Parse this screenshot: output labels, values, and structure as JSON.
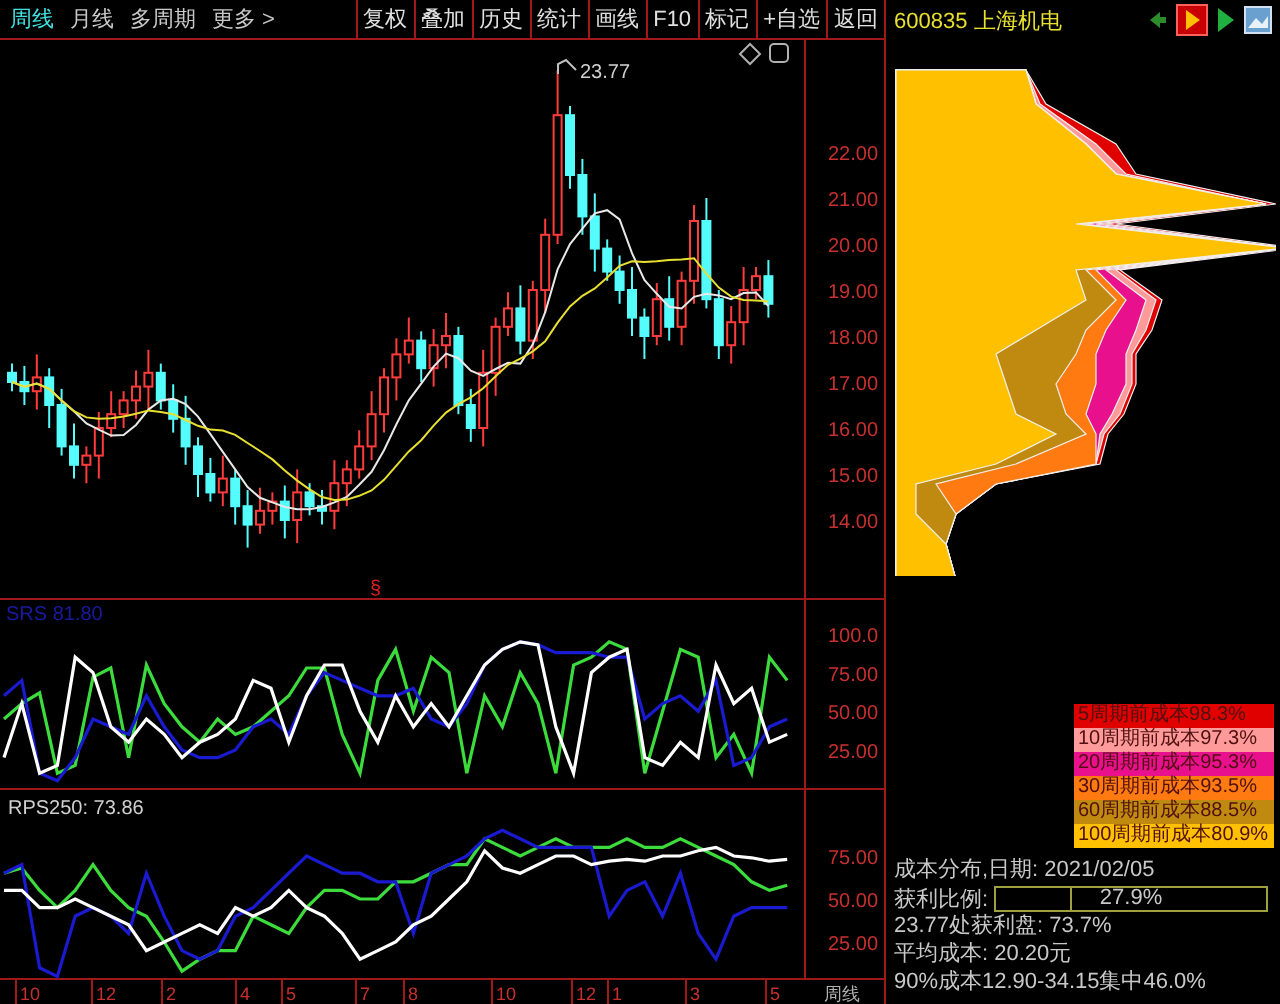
{
  "toolbar": {
    "period_tabs": [
      {
        "label": "周线",
        "selected": true
      },
      {
        "label": "月线",
        "selected": false
      },
      {
        "label": "多周期",
        "selected": false
      },
      {
        "label": "更多 >",
        "selected": false
      }
    ],
    "buttons": [
      "复权",
      "叠加",
      "历史",
      "统计",
      "画线",
      "F10",
      "标记",
      "+自选",
      "返回"
    ]
  },
  "stock": {
    "code": "600835",
    "name": "上海机电"
  },
  "price_chart": {
    "high_marker": "23.77",
    "price_labels": [
      "22.00",
      "21.00",
      "20.00",
      "19.00",
      "18.00",
      "17.00",
      "16.00",
      "15.00",
      "14.00"
    ],
    "event_mark": "§"
  },
  "indicator_1": {
    "label": "SRS 81.80",
    "axis_labels": [
      "100.0",
      "75.00",
      "50.00",
      "25.00"
    ]
  },
  "indicator_2": {
    "label": "RPS250: 73.86",
    "axis_labels": [
      "75.00",
      "50.00",
      "25.00"
    ]
  },
  "x_axis": {
    "labels": [
      "10",
      "12",
      "2",
      "4",
      "5",
      "7",
      "8",
      "10",
      "12",
      "1",
      "3",
      "5"
    ],
    "period": "周线"
  },
  "cost_distribution": {
    "legend": [
      {
        "label": "5周期前成本98.3%",
        "color": "#e00000"
      },
      {
        "label": "10周期前成本97.3%",
        "color": "#ff9a9a"
      },
      {
        "label": "20周期前成本95.3%",
        "color": "#e8108c"
      },
      {
        "label": "30周期前成本93.5%",
        "color": "#ff7a10"
      },
      {
        "label": "60周期前成本88.5%",
        "color": "#c08a10"
      },
      {
        "label": "100周期前成本80.9%",
        "color": "#ffc000"
      }
    ],
    "date_line": "成本分布,日期: 2021/02/05",
    "profit_ratio": {
      "label": "获利比例:",
      "level": 0.279,
      "reading": "27.9%"
    },
    "lines": [
      "23.77处获利盘: 73.7%",
      "平均成本: 20.20元",
      "90%成本12.90-34.15集中46.0%"
    ]
  }
}
